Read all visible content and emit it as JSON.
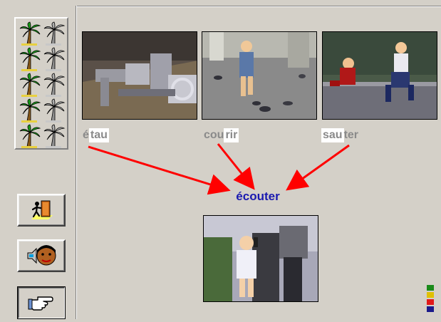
{
  "sidebar": {
    "palm_rows": 5,
    "exit_button_icon": "exit-door-icon",
    "listen_button_icon": "speaker-face-icon",
    "hand_button_icon": "pointing-hand-icon"
  },
  "source_words": [
    {
      "parts": [
        "é",
        "tau"
      ],
      "highlight_index": 1
    },
    {
      "parts": [
        "cou",
        "rir"
      ],
      "highlight_index": 1
    },
    {
      "parts": [
        "sau",
        "ter"
      ],
      "highlight_index": 0
    }
  ],
  "target": {
    "word": "écouter"
  },
  "colors": {
    "arrow": "#ff0000",
    "target_text": "#1a1ab0",
    "syllable_text": "#8a8a8a",
    "background": "#d4d0c8"
  }
}
